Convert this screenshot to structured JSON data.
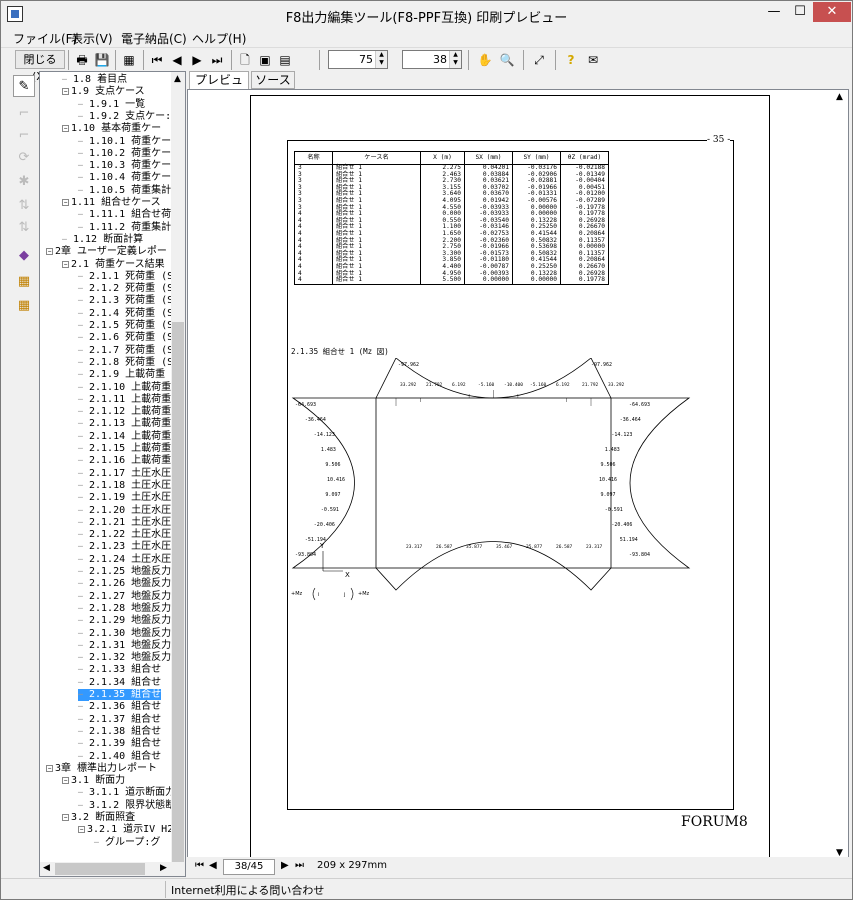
{
  "window": {
    "title": "F8出力編集ツール(F8-PPF互換) 印刷プレビュー",
    "min": "—",
    "max": "☐",
    "close": "✕"
  },
  "menu": [
    "ファイル(F)",
    "表示(V)",
    "電子納品(C)",
    "ヘルプ(H)"
  ],
  "toolbar": {
    "close_label": "閉じる(X)",
    "zoom_value": "75",
    "page_value": "38"
  },
  "tree": {
    "items": [
      {
        "label": "1.8 着目点",
        "indent": 1,
        "box": ""
      },
      {
        "label": "1.9 支点ケース",
        "indent": 1,
        "box": "−"
      },
      {
        "label": "1.9.1 一覧",
        "indent": 2,
        "box": ""
      },
      {
        "label": "1.9.2 支点ケー:",
        "indent": 2,
        "box": ""
      },
      {
        "label": "1.10 基本荷重ケー",
        "indent": 1,
        "box": "−"
      },
      {
        "label": "1.10.1 荷重ケー",
        "indent": 2,
        "box": ""
      },
      {
        "label": "1.10.2 荷重ケー",
        "indent": 2,
        "box": ""
      },
      {
        "label": "1.10.3 荷重ケー",
        "indent": 2,
        "box": ""
      },
      {
        "label": "1.10.4 荷重ケー",
        "indent": 2,
        "box": ""
      },
      {
        "label": "1.10.5 荷重集計",
        "indent": 2,
        "box": ""
      },
      {
        "label": "1.11 組合せケース",
        "indent": 1,
        "box": "−"
      },
      {
        "label": "1.11.1 組合せ荷",
        "indent": 2,
        "box": ""
      },
      {
        "label": "1.11.2 荷重集計",
        "indent": 2,
        "box": ""
      },
      {
        "label": "1.12 断面計算",
        "indent": 1,
        "box": ""
      },
      {
        "label": "2章 ユーザー定義レポー",
        "indent": 0,
        "box": "−"
      },
      {
        "label": "2.1 荷重ケース結果",
        "indent": 1,
        "box": "−"
      },
      {
        "label": "2.1.1 死荷重 (S",
        "indent": 2,
        "box": ""
      },
      {
        "label": "2.1.2 死荷重 (S",
        "indent": 2,
        "box": ""
      },
      {
        "label": "2.1.3 死荷重 (S",
        "indent": 2,
        "box": ""
      },
      {
        "label": "2.1.4 死荷重 (S",
        "indent": 2,
        "box": ""
      },
      {
        "label": "2.1.5 死荷重 (S",
        "indent": 2,
        "box": ""
      },
      {
        "label": "2.1.6 死荷重 (S",
        "indent": 2,
        "box": ""
      },
      {
        "label": "2.1.7 死荷重 (S",
        "indent": 2,
        "box": ""
      },
      {
        "label": "2.1.8 死荷重 (S",
        "indent": 2,
        "box": ""
      },
      {
        "label": "2.1.9 上載荷重",
        "indent": 2,
        "box": ""
      },
      {
        "label": "2.1.10 上載荷重",
        "indent": 2,
        "box": ""
      },
      {
        "label": "2.1.11 上載荷重",
        "indent": 2,
        "box": ""
      },
      {
        "label": "2.1.12 上載荷重",
        "indent": 2,
        "box": ""
      },
      {
        "label": "2.1.13 上載荷重",
        "indent": 2,
        "box": ""
      },
      {
        "label": "2.1.14 上載荷重",
        "indent": 2,
        "box": ""
      },
      {
        "label": "2.1.15 上載荷重",
        "indent": 2,
        "box": ""
      },
      {
        "label": "2.1.16 上載荷重",
        "indent": 2,
        "box": ""
      },
      {
        "label": "2.1.17 土圧水圧",
        "indent": 2,
        "box": ""
      },
      {
        "label": "2.1.18 土圧水圧",
        "indent": 2,
        "box": ""
      },
      {
        "label": "2.1.19 土圧水圧",
        "indent": 2,
        "box": ""
      },
      {
        "label": "2.1.20 土圧水圧",
        "indent": 2,
        "box": ""
      },
      {
        "label": "2.1.21 土圧水圧",
        "indent": 2,
        "box": ""
      },
      {
        "label": "2.1.22 土圧水圧",
        "indent": 2,
        "box": ""
      },
      {
        "label": "2.1.23 土圧水圧",
        "indent": 2,
        "box": ""
      },
      {
        "label": "2.1.24 土圧水圧",
        "indent": 2,
        "box": ""
      },
      {
        "label": "2.1.25 地盤反力",
        "indent": 2,
        "box": ""
      },
      {
        "label": "2.1.26 地盤反力",
        "indent": 2,
        "box": ""
      },
      {
        "label": "2.1.27 地盤反力",
        "indent": 2,
        "box": ""
      },
      {
        "label": "2.1.28 地盤反力",
        "indent": 2,
        "box": ""
      },
      {
        "label": "2.1.29 地盤反力",
        "indent": 2,
        "box": ""
      },
      {
        "label": "2.1.30 地盤反力",
        "indent": 2,
        "box": ""
      },
      {
        "label": "2.1.31 地盤反力",
        "indent": 2,
        "box": ""
      },
      {
        "label": "2.1.32 地盤反力",
        "indent": 2,
        "box": ""
      },
      {
        "label": "2.1.33 組合せ",
        "indent": 2,
        "box": ""
      },
      {
        "label": "2.1.34 組合せ",
        "indent": 2,
        "box": ""
      },
      {
        "label": "2.1.35 組合せ",
        "indent": 2,
        "box": "",
        "selected": true
      },
      {
        "label": "2.1.36 組合せ",
        "indent": 2,
        "box": ""
      },
      {
        "label": "2.1.37 組合せ",
        "indent": 2,
        "box": ""
      },
      {
        "label": "2.1.38 組合せ",
        "indent": 2,
        "box": ""
      },
      {
        "label": "2.1.39 組合せ",
        "indent": 2,
        "box": ""
      },
      {
        "label": "2.1.40 組合せ",
        "indent": 2,
        "box": ""
      },
      {
        "label": "3章 標準出力レポート",
        "indent": 0,
        "box": "−"
      },
      {
        "label": "3.1 断面力",
        "indent": 1,
        "box": "−"
      },
      {
        "label": "3.1.1 道示断面力",
        "indent": 2,
        "box": ""
      },
      {
        "label": "3.1.2 限界状態断",
        "indent": 2,
        "box": ""
      },
      {
        "label": "3.2 断面照査",
        "indent": 1,
        "box": "−"
      },
      {
        "label": "3.2.1 道示IV H2",
        "indent": 2,
        "box": "−"
      },
      {
        "label": "グループ:グ",
        "indent": 3,
        "box": ""
      }
    ]
  },
  "tabs": [
    "プレビュー",
    "ソース"
  ],
  "preview": {
    "page_number": "- 35 -",
    "table": {
      "headers": [
        "名称",
        "ケース名",
        "X (m)",
        "SX (mm)",
        "SY (mm)",
        "θZ (mrad)"
      ],
      "rows": [
        [
          "3",
          "組合せ 1",
          "2.275",
          "0.04201",
          "-0.03176",
          "-0.02188"
        ],
        [
          "3",
          "組合せ 1",
          "2.463",
          "0.03884",
          "-0.02906",
          "-0.01349"
        ],
        [
          "3",
          "組合せ 1",
          "2.730",
          "0.03621",
          "-0.02881",
          "-0.00404"
        ],
        [
          "3",
          "組合せ 1",
          "3.155",
          "0.03702",
          "-0.01966",
          "0.00451"
        ],
        [
          "3",
          "組合せ 1",
          "3.640",
          "0.03670",
          "-0.01331",
          "-0.01200"
        ],
        [
          "3",
          "組合せ 1",
          "4.095",
          "0.01942",
          "-0.00576",
          "-0.07289"
        ],
        [
          "3",
          "組合せ 1",
          "4.550",
          "-0.03933",
          "0.00000",
          "-0.19778"
        ],
        [
          "4",
          "組合せ 1",
          "0.000",
          "-0.03933",
          "0.00000",
          "0.19778"
        ],
        [
          "4",
          "組合せ 1",
          "0.550",
          "-0.03540",
          "0.13228",
          "0.26928"
        ],
        [
          "4",
          "組合せ 1",
          "1.100",
          "-0.03146",
          "0.25250",
          "0.26670"
        ],
        [
          "4",
          "組合せ 1",
          "1.650",
          "-0.02753",
          "0.41544",
          "0.20864"
        ],
        [
          "4",
          "組合せ 1",
          "2.200",
          "-0.02360",
          "0.50832",
          "0.11357"
        ],
        [
          "4",
          "組合せ 1",
          "2.750",
          "-0.01966",
          "0.53698",
          "0.00000"
        ],
        [
          "4",
          "組合せ 1",
          "3.300",
          "-0.01573",
          "0.50832",
          "0.11357"
        ],
        [
          "4",
          "組合せ 1",
          "3.850",
          "-0.01180",
          "0.41544",
          "0.20864"
        ],
        [
          "4",
          "組合せ 1",
          "4.400",
          "-0.00787",
          "0.25250",
          "0.26670"
        ],
        [
          "4",
          "組合せ 1",
          "4.950",
          "-0.00393",
          "0.13228",
          "0.26928"
        ],
        [
          "4",
          "組合せ 1",
          "5.500",
          "0.00000",
          "0.00000",
          "0.19778"
        ]
      ]
    },
    "diagram_title": "2.1.35 組合せ 1 (Mz 図)",
    "diagram_labels": {
      "top_left": "-97.962",
      "top_right": "-97.962",
      "left": [
        "-64.693",
        "-36.464",
        "-14.123",
        "1.483",
        "9.506",
        "10.416",
        "9.097",
        "-0.591",
        "-20.406",
        "-51.194",
        "-93.804"
      ],
      "right": [
        "-64.693",
        "-36.464",
        "-14.123",
        "1.483",
        "9.506",
        "10.416",
        "9.097",
        "-0.591",
        "-20.406",
        "51.194",
        "-93.804"
      ],
      "top_inner": [
        "33.292",
        "21.792",
        "6.192",
        "-5.160",
        "-10.400",
        "-5.160",
        "6.192",
        "21.792",
        "33.292"
      ],
      "bottom_inner": [
        "23.317",
        "26.587",
        "35.877",
        "35.467",
        "35.877",
        "26.587",
        "23.317"
      ],
      "axis_y": "Y",
      "axis_x": "X",
      "moment_left": "+Mz",
      "moment_right": "+Mz",
      "node_i": "i",
      "node_j": "j"
    },
    "footer_logo": "FORUM8"
  },
  "pager": {
    "current": "38/45",
    "paper_size": "209 x 297mm"
  },
  "status": "Internet利用による問い合わせ"
}
